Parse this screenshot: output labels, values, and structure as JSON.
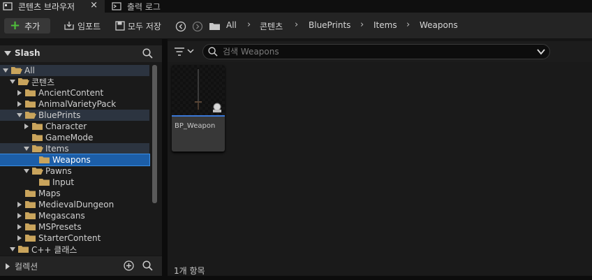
{
  "tabs": {
    "content_browser": "콘텐츠 브라우저",
    "close": "×",
    "output_log": "출력 로그"
  },
  "toolbar": {
    "add_label": "추가",
    "import_label": "임포트",
    "save_all_label": "모두 저장"
  },
  "breadcrumb": [
    "All",
    "콘텐츠",
    "BluePrints",
    "Items",
    "Weapons"
  ],
  "sources": {
    "title": "Slash",
    "collections_label": "컬렉션"
  },
  "tree": [
    {
      "label": "All",
      "expanded": true
    },
    {
      "label": "콘텐츠",
      "expanded": true
    },
    {
      "label": "AncientContent",
      "expanded": false
    },
    {
      "label": "AnimalVarietyPack",
      "expanded": false
    },
    {
      "label": "BluePrints",
      "expanded": true
    },
    {
      "label": "Character",
      "expanded": false
    },
    {
      "label": "GameMode",
      "expanded": null
    },
    {
      "label": "Items",
      "expanded": true
    },
    {
      "label": "Weapons",
      "expanded": null,
      "selected": true
    },
    {
      "label": "Pawns",
      "expanded": true
    },
    {
      "label": "Input",
      "expanded": null
    },
    {
      "label": "Maps",
      "expanded": null
    },
    {
      "label": "MedievalDungeon",
      "expanded": false
    },
    {
      "label": "Megascans",
      "expanded": false
    },
    {
      "label": "MSPresets",
      "expanded": false
    },
    {
      "label": "StarterContent",
      "expanded": false
    },
    {
      "label": "C++ 클래스",
      "expanded": true
    }
  ],
  "search": {
    "placeholder": "검색 Weapons"
  },
  "assets": [
    {
      "name": "BP_Weapon"
    }
  ],
  "status": {
    "item_count": "1개 항목"
  },
  "colors": {
    "accent_green": "#4fbf3a",
    "folder_yellow": "#c9a45c",
    "selection_blue": "#1c5ea8",
    "blueprint_bar": "#3a78d8"
  }
}
